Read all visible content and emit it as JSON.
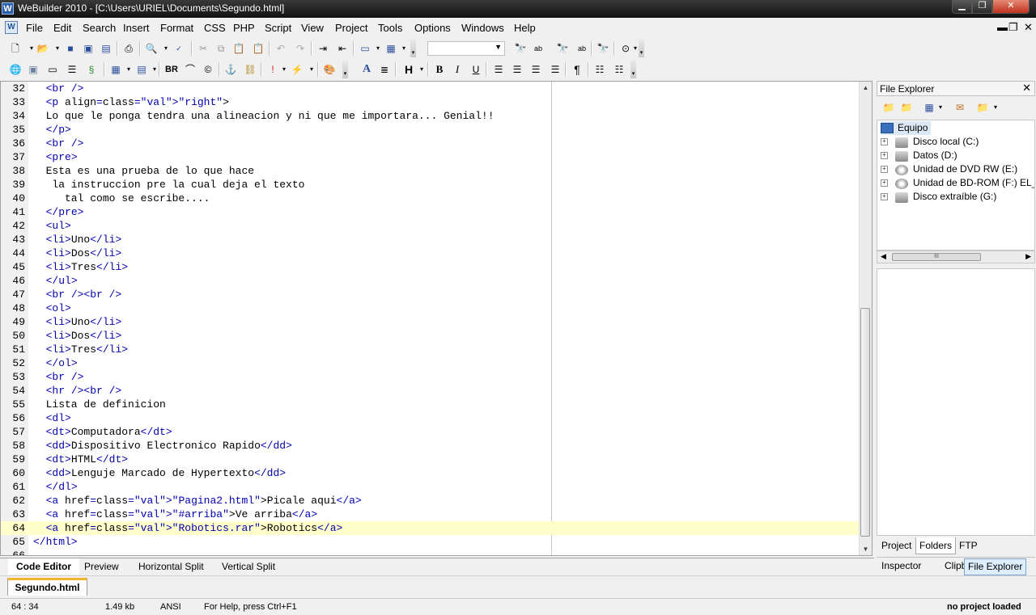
{
  "window": {
    "title": "WeBuilder 2010 - [C:\\Users\\URIEL\\Documents\\Segundo.html]"
  },
  "menu": {
    "items": [
      "File",
      "Edit",
      "Search",
      "Insert",
      "Format",
      "CSS",
      "PHP",
      "Script",
      "View",
      "Project",
      "Tools",
      "Options",
      "Windows",
      "Help"
    ]
  },
  "toolbar": {
    "format_buttons": {
      "br_label": "BR",
      "heading_label": "H",
      "bold_label": "B",
      "italic_label": "I",
      "underline_label": "U",
      "paragraph_label": "¶",
      "font_label": "A"
    },
    "font_combo_value": ""
  },
  "editor": {
    "current_line": 64,
    "lines": [
      {
        "n": "32",
        "c": "  <br />"
      },
      {
        "n": "33",
        "c": "  <p align=\"right\">"
      },
      {
        "n": "34",
        "c": "  Lo que le ponga tendra una alineacion y ni que me importara... Genial!!"
      },
      {
        "n": "35",
        "c": "  </p>"
      },
      {
        "n": "36",
        "c": "  <br />"
      },
      {
        "n": "37",
        "c": "  <pre>"
      },
      {
        "n": "38",
        "c": "  Esta es una prueba de lo que hace"
      },
      {
        "n": "39",
        "c": "   la instruccion pre la cual deja el texto"
      },
      {
        "n": "40",
        "c": "     tal como se escribe...."
      },
      {
        "n": "41",
        "c": "  </pre>"
      },
      {
        "n": "42",
        "c": "  <ul>"
      },
      {
        "n": "43",
        "c": "  <li>Uno</li>"
      },
      {
        "n": "44",
        "c": "  <li>Dos</li>"
      },
      {
        "n": "45",
        "c": "  <li>Tres</li>"
      },
      {
        "n": "46",
        "c": "  </ul>"
      },
      {
        "n": "47",
        "c": "  <br /><br />"
      },
      {
        "n": "48",
        "c": "  <ol>"
      },
      {
        "n": "49",
        "c": "  <li>Uno</li>"
      },
      {
        "n": "50",
        "c": "  <li>Dos</li>"
      },
      {
        "n": "51",
        "c": "  <li>Tres</li>"
      },
      {
        "n": "52",
        "c": "  </ol>"
      },
      {
        "n": "53",
        "c": "  <br />"
      },
      {
        "n": "54",
        "c": "  <hr /><br />"
      },
      {
        "n": "55",
        "c": "  Lista de definicion"
      },
      {
        "n": "56",
        "c": "  <dl>"
      },
      {
        "n": "57",
        "c": "  <dt>Computadora</dt>"
      },
      {
        "n": "58",
        "c": "  <dd>Dispositivo Electronico Rapido</dd>"
      },
      {
        "n": "59",
        "c": "  <dt>HTML</dt>"
      },
      {
        "n": "60",
        "c": "  <dd>Lenguje Marcado de Hypertexto</dd>"
      },
      {
        "n": "61",
        "c": "  </dl>"
      },
      {
        "n": "62",
        "c": "  <a href=\"Pagina2.html\">Picale aqui</a>"
      },
      {
        "n": "63",
        "c": "  <a href=\"#arriba\">Ve arriba</a>"
      },
      {
        "n": "64",
        "c": "  <a href=\"Robotics.rar\">Robotics</a>"
      },
      {
        "n": "65",
        "c": "</html>"
      },
      {
        "n": "66",
        "c": ""
      }
    ]
  },
  "editor_tabs": {
    "code_editor": "Code Editor",
    "preview": "Preview",
    "horizontal_split": "Horizontal Split",
    "vertical_split": "Vertical Split"
  },
  "document_tab": {
    "label": "Segundo.html"
  },
  "status": {
    "position": "64 : 34",
    "size": "1.49 kb",
    "encoding": "ANSI",
    "help": "For Help, press Ctrl+F1",
    "project": "no project loaded"
  },
  "file_explorer": {
    "title": "File Explorer",
    "root": "Equipo",
    "drives": [
      "Disco local (C:)",
      "Datos (D:)",
      "Unidad de DVD RW (E:)",
      "Unidad de BD-ROM (F:) EL_SEN",
      "Disco extraíble (G:)"
    ],
    "scroll_thumb_label": "III"
  },
  "panel_tabs": {
    "project": "Project",
    "folders": "Folders",
    "ftp": "FTP"
  },
  "bottom_panel_tabs": {
    "inspector": "Inspector",
    "clipboard": "Clipboard",
    "file_explorer": "File Explorer"
  },
  "colors": {
    "tag": "#0000b0",
    "attr_value": "#2779d0",
    "current_line": "#ffffcc",
    "doc_tab_accent": "#f2b52f"
  }
}
